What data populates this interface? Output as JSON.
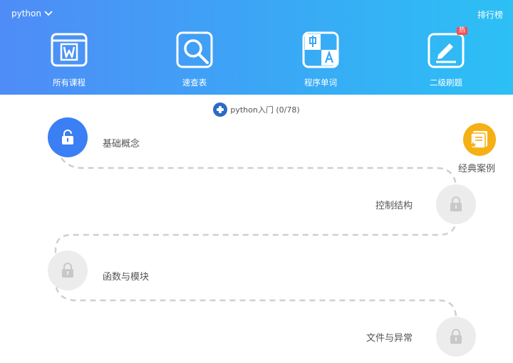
{
  "header": {
    "language": "python",
    "rank_label": "排行榜",
    "nav": [
      {
        "label": "所有课程",
        "icon": "word-book-icon"
      },
      {
        "label": "速查表",
        "icon": "search-icon"
      },
      {
        "label": "程序单词",
        "icon": "translate-icon"
      },
      {
        "label": "二级刷题",
        "icon": "edit-icon",
        "badge": "热"
      }
    ]
  },
  "course": {
    "title": "python入门 (0/78)"
  },
  "lessons": [
    {
      "label": "基础概念",
      "state": "unlocked"
    },
    {
      "label": "控制结构",
      "state": "locked"
    },
    {
      "label": "函数与模块",
      "state": "locked"
    },
    {
      "label": "文件与异常",
      "state": "locked"
    }
  ],
  "extra": {
    "cases_label": "经典案例"
  },
  "colors": {
    "header_gradient_start": "#4f8cf7",
    "header_gradient_end": "#2cc0f5",
    "unlocked_node": "#3a7ff3",
    "locked_node": "#ececec",
    "cases_badge": "#f5b014"
  }
}
